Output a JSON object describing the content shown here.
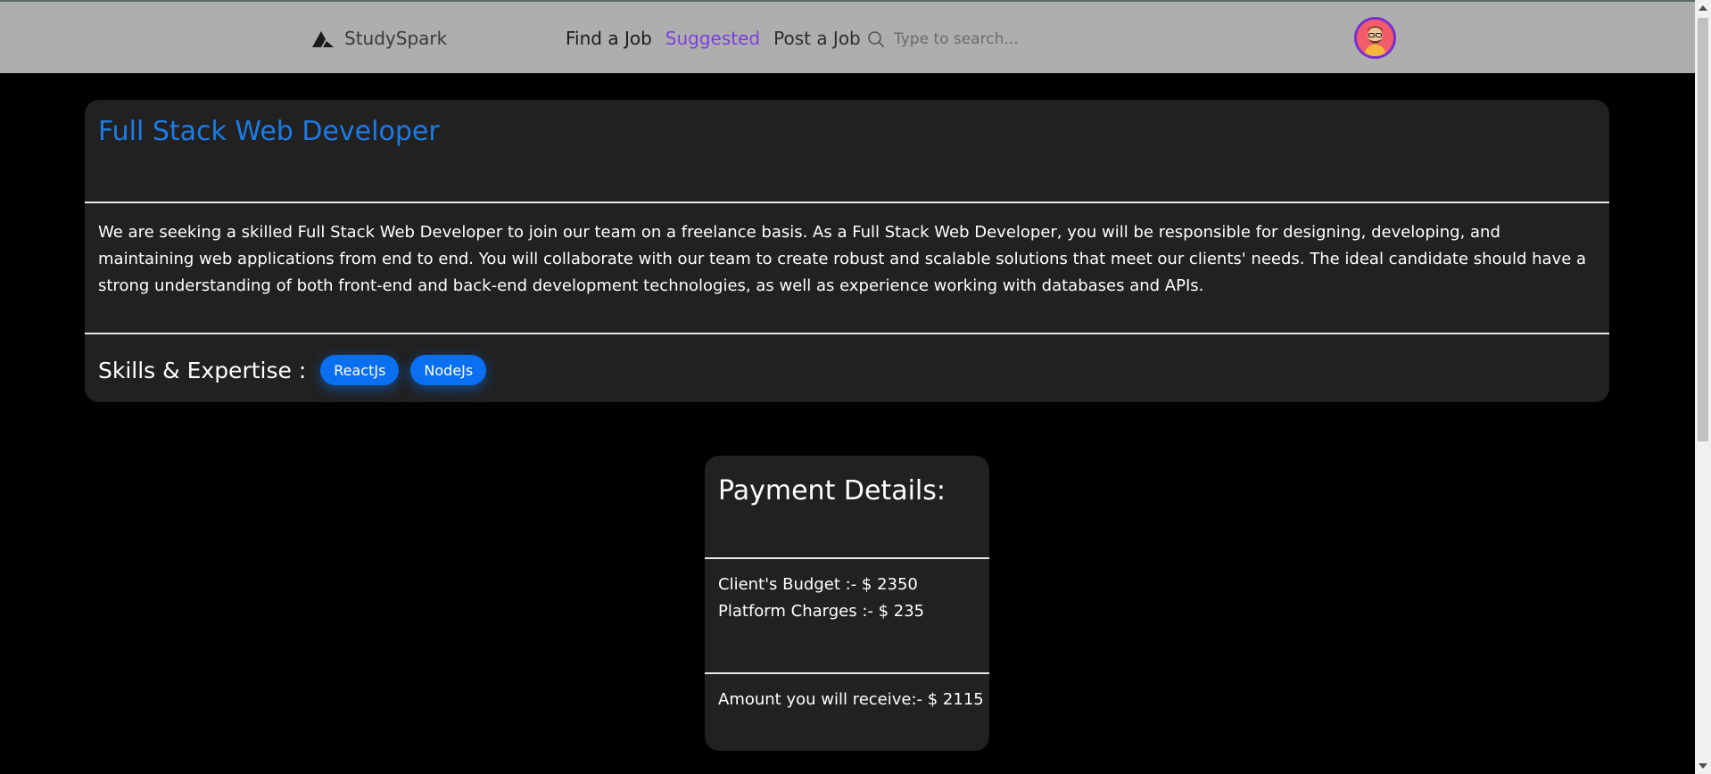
{
  "navbar": {
    "brand": "StudySpark",
    "links": [
      {
        "label": "Find a Job"
      },
      {
        "label": "Suggested"
      },
      {
        "label": "Post a Job"
      }
    ],
    "search_placeholder": "Type to search..."
  },
  "job": {
    "title": "Full Stack Web Developer",
    "description": "We are seeking a skilled Full Stack Web Developer to join our team on a freelance basis. As a Full Stack Web Developer, you will be responsible for designing, developing, and maintaining web applications from end to end. You will collaborate with our team to create robust and scalable solutions that meet our clients' needs. The ideal candidate should have a strong understanding of both front-end and back-end development technologies, as well as experience working with databases and APIs.",
    "skills_label": "Skills & Expertise :",
    "skills": [
      "ReactJs",
      "NodeJs"
    ]
  },
  "payment": {
    "title": "Payment Details:",
    "client_budget": "Client's Budget :- $ 2350",
    "platform_charges": "Platform Charges :- $ 235",
    "amount_receive": "Amount you will receive:- $ 2115"
  },
  "colors": {
    "navbar_bg": "#aeaeae",
    "accent_purple": "#7b3fe0",
    "title_blue": "#1d7be5",
    "chip_blue": "#0a6ff0",
    "card_bg": "#212121"
  }
}
